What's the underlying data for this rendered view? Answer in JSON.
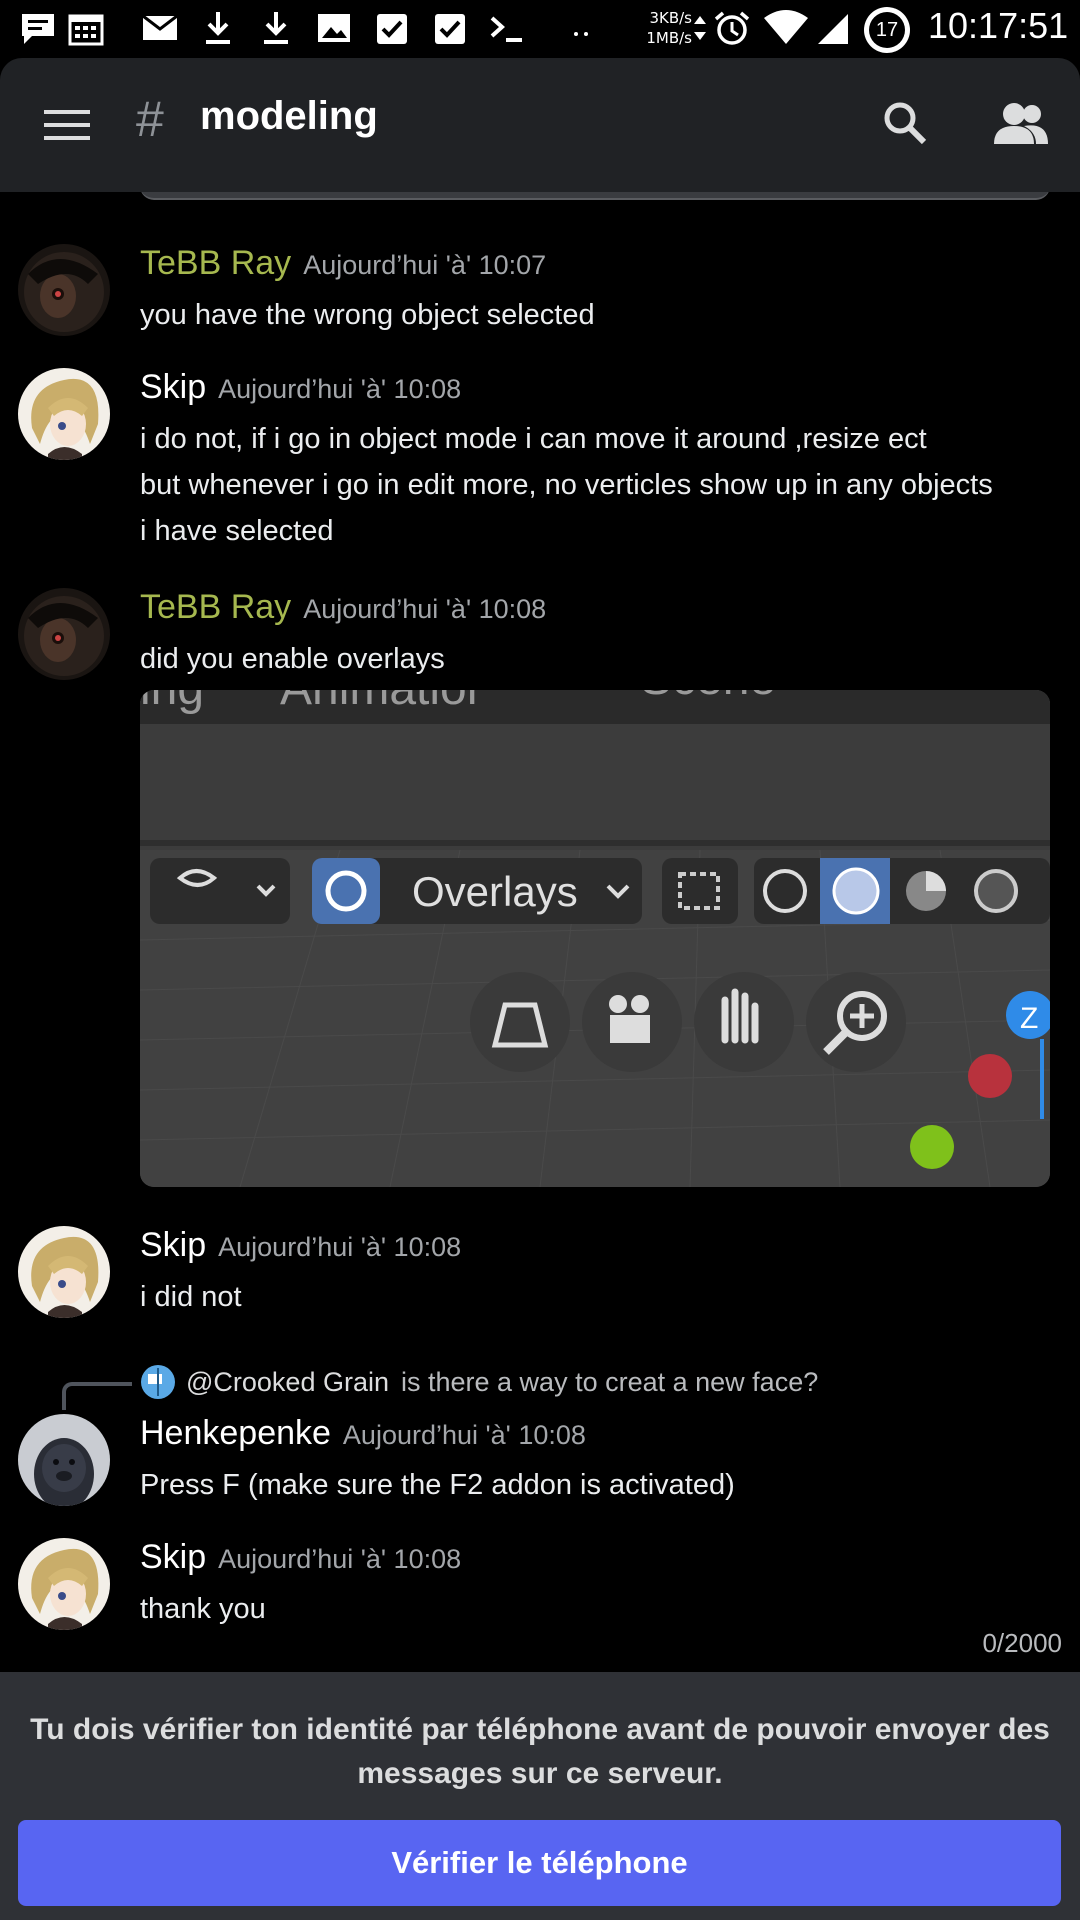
{
  "status_bar": {
    "net_up": "3KB/s",
    "net_down": "1MB/s",
    "notification_count": "17",
    "time": "10:17:51"
  },
  "header": {
    "channel_name": "modeling",
    "hash": "#"
  },
  "messages": [
    {
      "author": "TeBB Ray",
      "timestamp": "Aujourd’hui 'à' 10:07",
      "lines": [
        "you have the wrong object selected"
      ]
    },
    {
      "author": "Skip",
      "timestamp": "Aujourd’hui 'à' 10:08",
      "lines": [
        "i do not, if i go in object mode i can move it around ,resize ect",
        "but whenever i go in edit more, no verticles show up in any objects",
        "i have selected"
      ]
    },
    {
      "author": "TeBB Ray",
      "timestamp": "Aujourd’hui 'à' 10:08",
      "lines": [
        "did you enable overlays"
      ]
    },
    {
      "author": "Skip",
      "timestamp": "Aujourd’hui 'à' 10:08",
      "lines": [
        "i did not"
      ]
    },
    {
      "author": "Henkepenke",
      "timestamp": "Aujourd’hui 'à' 10:08",
      "lines": [
        "Press F (make sure the F2 addon is activated)"
      ],
      "reply": {
        "mention": "@Crooked Grain",
        "text": "is there a way to creat a new face?"
      }
    },
    {
      "author": "Skip",
      "timestamp": "Aujourd’hui 'à' 10:08",
      "lines": [
        "thank you"
      ]
    }
  ],
  "embed": {
    "tab_fragments": [
      "ing",
      "Animatior",
      "Scene"
    ],
    "overlays_label": "Overlays",
    "axis_label": "Z"
  },
  "composer": {
    "char_counter": "0/2000",
    "verify_notice": "Tu dois vérifier ton identité par téléphone avant de pouvoir envoyer des messages sur ce serveur.",
    "verify_button": "Vérifier le téléphone"
  },
  "colors": {
    "accent": "#5865f2",
    "tebb_name": "#a6b84f",
    "header_bg": "#202225",
    "bottom_bg": "#2f3136"
  },
  "icons": [
    "menu-icon",
    "search-icon",
    "members-icon"
  ]
}
